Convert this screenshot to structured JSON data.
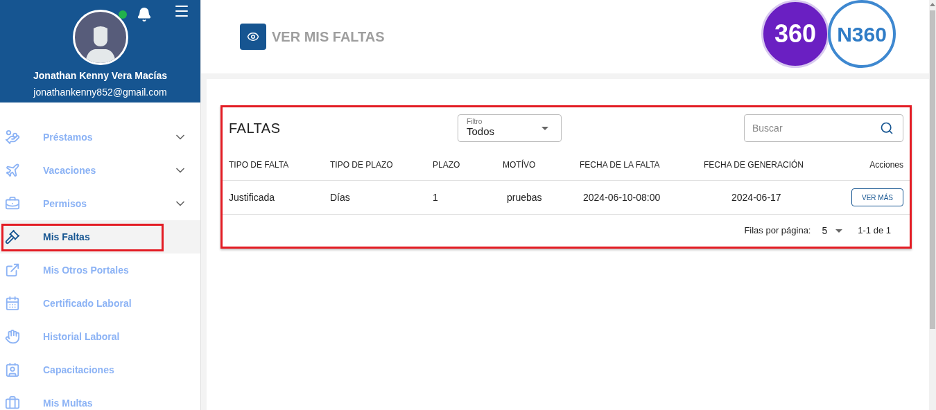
{
  "user": {
    "name": "Jonathan Kenny Vera Macías",
    "email": "jonathankenny852@gmail.com",
    "online": true
  },
  "menu": [
    {
      "label": "Préstamos",
      "expandable": true,
      "selected": false
    },
    {
      "label": "Vacaciones",
      "expandable": true,
      "selected": false
    },
    {
      "label": "Permisos",
      "expandable": true,
      "selected": false
    },
    {
      "label": "Mis Faltas",
      "expandable": false,
      "selected": true
    },
    {
      "label": "Mis Otros Portales",
      "expandable": false,
      "selected": false
    },
    {
      "label": "Certificado Laboral",
      "expandable": false,
      "selected": false
    },
    {
      "label": "Historial Laboral",
      "expandable": false,
      "selected": false
    },
    {
      "label": "Capacitaciones",
      "expandable": false,
      "selected": false
    },
    {
      "label": "Mis Multas",
      "expandable": false,
      "selected": false
    }
  ],
  "page": {
    "title": "VER MIS FALTAS",
    "logos": [
      "360",
      "N360"
    ]
  },
  "table": {
    "title": "FALTAS",
    "filter": {
      "label": "Filtro",
      "value": "Todos"
    },
    "search": {
      "placeholder": "Buscar"
    },
    "columns": [
      "TIPO DE FALTA",
      "TIPO DE PLAZO",
      "PLAZO",
      "MOTÍVO",
      "FECHA DE LA FALTA",
      "FECHA DE GENERACIÓN",
      "Acciones"
    ],
    "rows": [
      {
        "cells": [
          "Justificada",
          "Días",
          "1",
          "pruebas",
          "2024-06-10-08:00",
          "2024-06-17"
        ],
        "action": "VER MÁS"
      }
    ],
    "pagination": {
      "label": "Filas por página:",
      "per_page": "5",
      "range": "1-1 de 1"
    }
  }
}
